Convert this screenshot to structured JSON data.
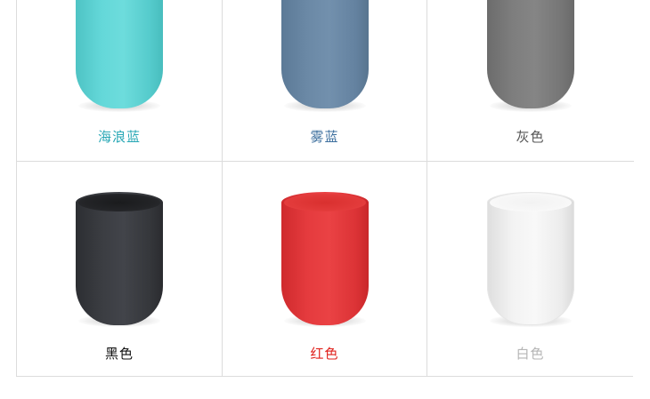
{
  "products": [
    {
      "label": "海浪蓝",
      "label_color": "#2aa8b6",
      "cup_color": "#5fd4d5",
      "cup_shade": "#4dc2c3"
    },
    {
      "label": "雾蓝",
      "label_color": "#3d6f9e",
      "cup_color": "#6c8aa7",
      "cup_shade": "#5c7995"
    },
    {
      "label": "灰色",
      "label_color": "#555555",
      "cup_color": "#7f7f7f",
      "cup_shade": "#6e6e6e"
    },
    {
      "label": "黑色",
      "label_color": "#111111",
      "cup_color": "#3a3c40",
      "cup_shade": "#2b2c30"
    },
    {
      "label": "红色",
      "label_color": "#e0201b",
      "cup_color": "#e83a3c",
      "cup_shade": "#cf2a2d"
    },
    {
      "label": "白色",
      "label_color": "#b5b5b5",
      "cup_color": "#f4f4f4",
      "cup_shade": "#e2e2e2"
    }
  ]
}
